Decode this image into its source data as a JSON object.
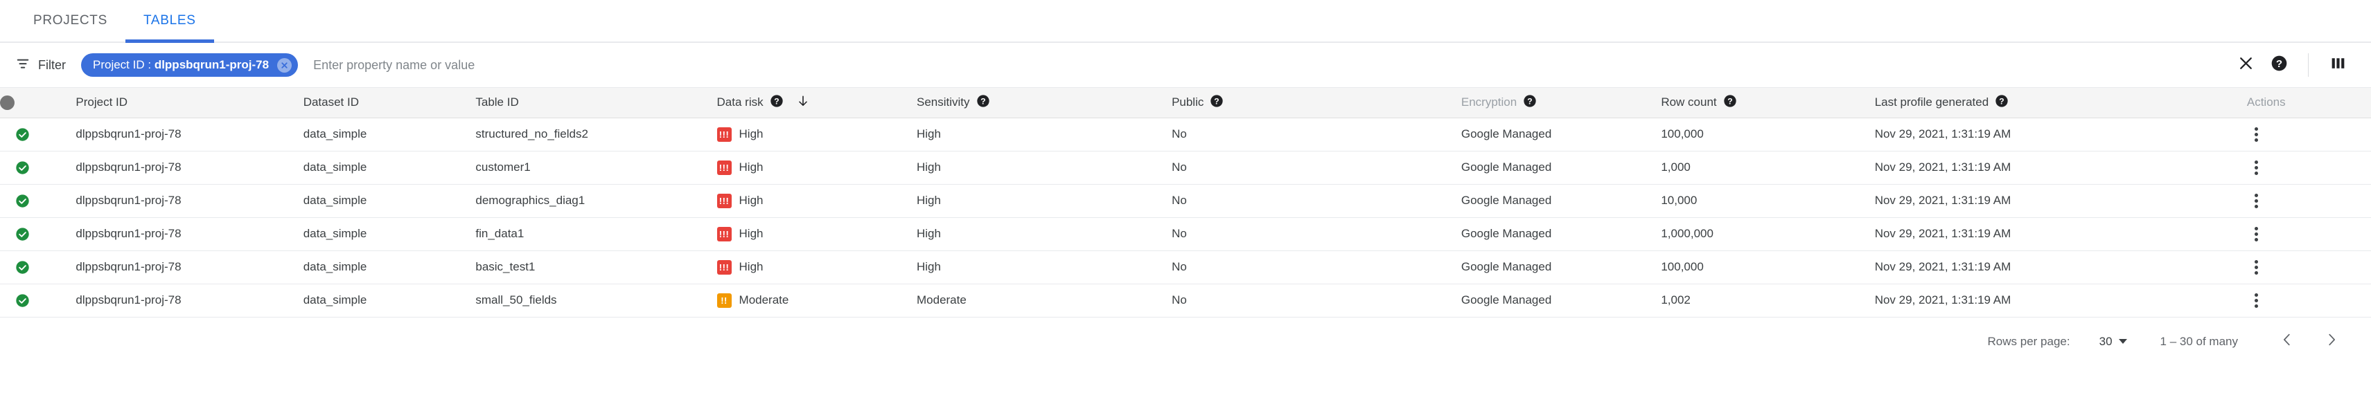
{
  "tabs": [
    {
      "label": "PROJECTS",
      "active": false
    },
    {
      "label": "TABLES",
      "active": true
    }
  ],
  "filter_bar": {
    "filter_label": "Filter",
    "chip": {
      "field": "Project ID",
      "separator": " : ",
      "value": "dlppsbqrun1-proj-78",
      "close_icon": "close-icon"
    },
    "input_placeholder": "Enter property name or value",
    "input_value": "",
    "actions": [
      {
        "icon": "close-icon",
        "name": "clear-filter-button"
      },
      {
        "icon": "help-icon",
        "name": "help-button"
      },
      {
        "icon": "columns-icon",
        "name": "column-display-options-button"
      }
    ]
  },
  "table": {
    "columns": [
      {
        "label": "",
        "icon": "status-circle-icon",
        "help": false,
        "dim": false
      },
      {
        "label": "Project ID",
        "help": false,
        "dim": false
      },
      {
        "label": "Dataset ID",
        "help": false,
        "dim": false
      },
      {
        "label": "Table ID",
        "help": false,
        "dim": false
      },
      {
        "label": "Data risk",
        "help": true,
        "sort": "descending",
        "dim": false
      },
      {
        "label": "Sensitivity",
        "help": true,
        "dim": false
      },
      {
        "label": "Public",
        "help": true,
        "dim": false
      },
      {
        "label": "Encryption",
        "help": true,
        "dim": true
      },
      {
        "label": "Row count",
        "help": true,
        "dim": false
      },
      {
        "label": "Last profile generated",
        "help": true,
        "dim": false
      },
      {
        "label": "Actions",
        "help": false,
        "dim": true
      }
    ],
    "rows": [
      {
        "status": "check-circle-icon",
        "project_id": "dlppsbqrun1-proj-78",
        "dataset_id": "data_simple",
        "table_id": "structured_no_fields2",
        "data_risk": "High",
        "data_risk_level": "high",
        "sensitivity": "High",
        "public": "No",
        "encryption": "Google Managed",
        "row_count": "100,000",
        "last_profile_generated": "Nov 29, 2021, 1:31:19 AM"
      },
      {
        "status": "check-circle-icon",
        "project_id": "dlppsbqrun1-proj-78",
        "dataset_id": "data_simple",
        "table_id": "customer1",
        "data_risk": "High",
        "data_risk_level": "high",
        "sensitivity": "High",
        "public": "No",
        "encryption": "Google Managed",
        "row_count": "1,000",
        "last_profile_generated": "Nov 29, 2021, 1:31:19 AM"
      },
      {
        "status": "check-circle-icon",
        "project_id": "dlppsbqrun1-proj-78",
        "dataset_id": "data_simple",
        "table_id": "demographics_diag1",
        "data_risk": "High",
        "data_risk_level": "high",
        "sensitivity": "High",
        "public": "No",
        "encryption": "Google Managed",
        "row_count": "10,000",
        "last_profile_generated": "Nov 29, 2021, 1:31:19 AM"
      },
      {
        "status": "check-circle-icon",
        "project_id": "dlppsbqrun1-proj-78",
        "dataset_id": "data_simple",
        "table_id": "fin_data1",
        "data_risk": "High",
        "data_risk_level": "high",
        "sensitivity": "High",
        "public": "No",
        "encryption": "Google Managed",
        "row_count": "1,000,000",
        "last_profile_generated": "Nov 29, 2021, 1:31:19 AM"
      },
      {
        "status": "check-circle-icon",
        "project_id": "dlppsbqrun1-proj-78",
        "dataset_id": "data_simple",
        "table_id": "basic_test1",
        "data_risk": "High",
        "data_risk_level": "high",
        "sensitivity": "High",
        "public": "No",
        "encryption": "Google Managed",
        "row_count": "100,000",
        "last_profile_generated": "Nov 29, 2021, 1:31:19 AM"
      },
      {
        "status": "check-circle-icon",
        "project_id": "dlppsbqrun1-proj-78",
        "dataset_id": "data_simple",
        "table_id": "small_50_fields",
        "data_risk": "Moderate",
        "data_risk_level": "moderate",
        "sensitivity": "Moderate",
        "public": "No",
        "encryption": "Google Managed",
        "row_count": "1,002",
        "last_profile_generated": "Nov 29, 2021, 1:31:19 AM"
      }
    ]
  },
  "footer": {
    "rows_per_page_label": "Rows per page:",
    "rows_per_page_value": "30",
    "range_label": "1 – 30 of many",
    "prev_icon": "chevron-left-icon",
    "next_icon": "chevron-right-icon"
  },
  "colors": {
    "accent": "#3b6fdb",
    "tab_active": "#1a73e8",
    "risk_high": "#e8413a",
    "risk_moderate": "#f29900",
    "status_ok": "#1e8e3e",
    "header_bg": "#f5f5f5"
  },
  "badges": {
    "high_glyph": "!!!",
    "moderate_glyph": "!!"
  }
}
